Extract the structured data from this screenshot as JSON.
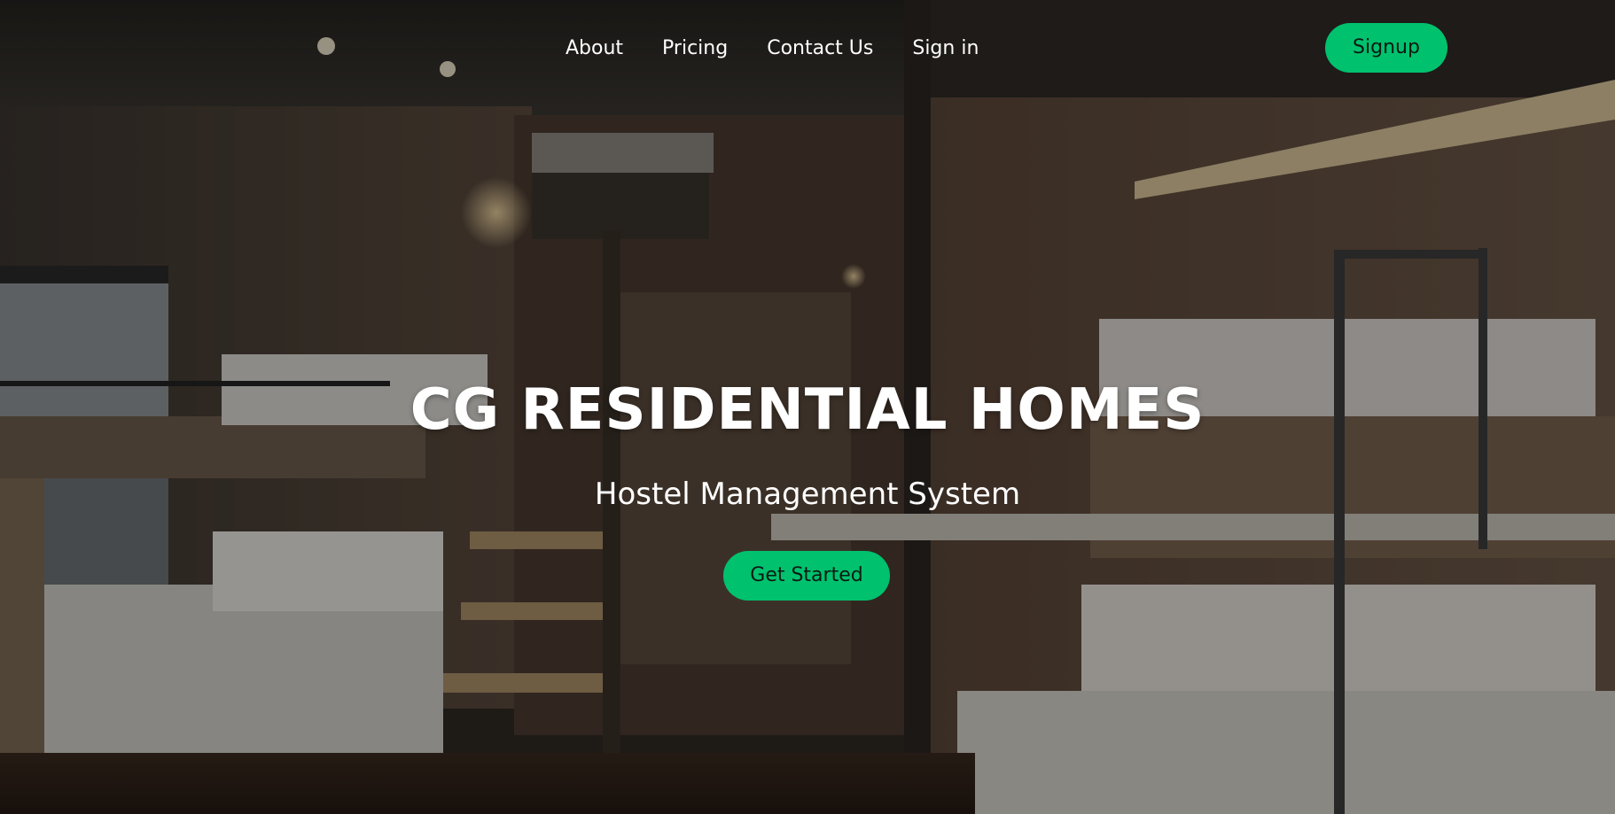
{
  "nav": {
    "links": [
      {
        "label": "About"
      },
      {
        "label": "Pricing"
      },
      {
        "label": "Contact Us"
      },
      {
        "label": "Sign in"
      }
    ],
    "signup_label": "Signup"
  },
  "hero": {
    "title": "CG RESIDENTIAL HOMES",
    "subtitle": "Hostel Management System",
    "cta_label": "Get Started"
  },
  "colors": {
    "accent": "#00c16e",
    "text": "#ffffff",
    "button_text": "#0b1a12"
  }
}
